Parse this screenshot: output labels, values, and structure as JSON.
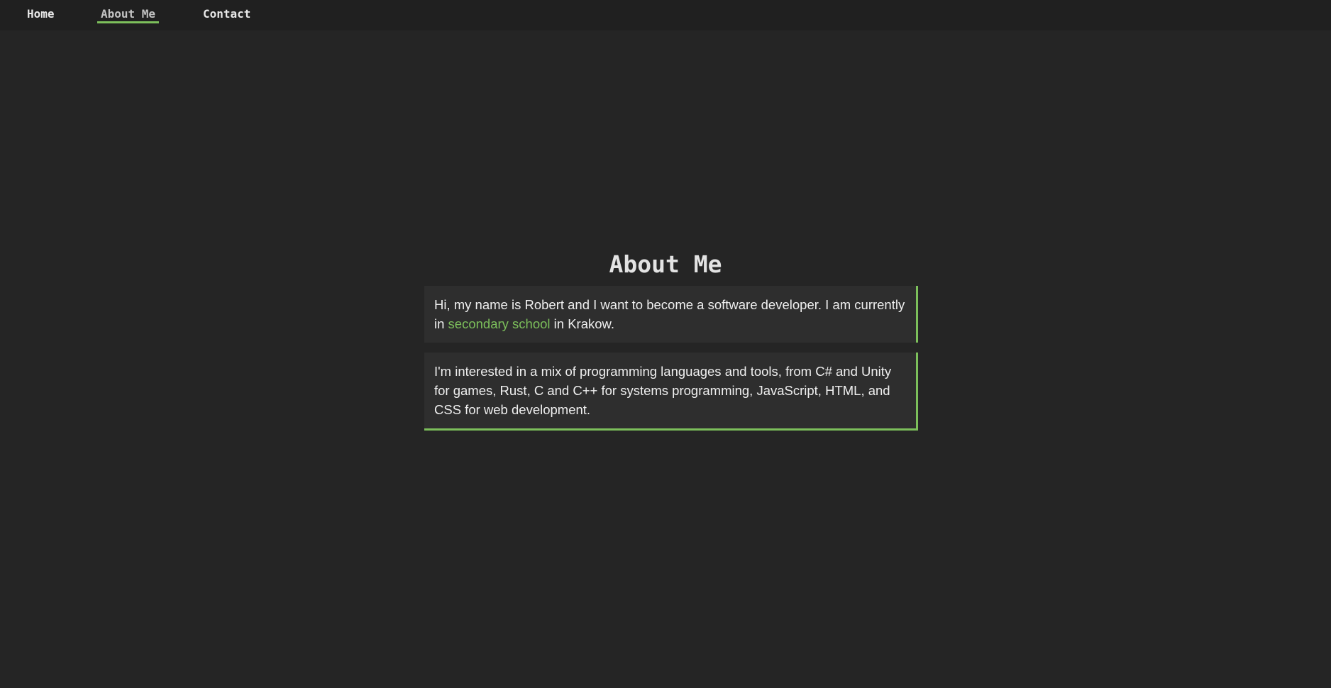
{
  "nav": {
    "items": [
      {
        "label": "Home"
      },
      {
        "label": "About Me",
        "active": true
      },
      {
        "label": "Contact"
      }
    ]
  },
  "main": {
    "title": "About Me",
    "card1": {
      "text_before": "Hi, my name is Robert and I want to become a software developer. I am currently in ",
      "highlight": "secondary school",
      "text_after": " in Krakow."
    },
    "card2": {
      "text": "I'm interested in a mix of programming languages and tools, from C# and Unity for games, Rust, C and C++ for systems programming, JavaScript, HTML, and CSS for web development."
    }
  },
  "colors": {
    "background": "#252525",
    "navbar": "#202020",
    "card": "#2e2e2e",
    "accent": "#7cbf5b",
    "text": "#efefef"
  }
}
